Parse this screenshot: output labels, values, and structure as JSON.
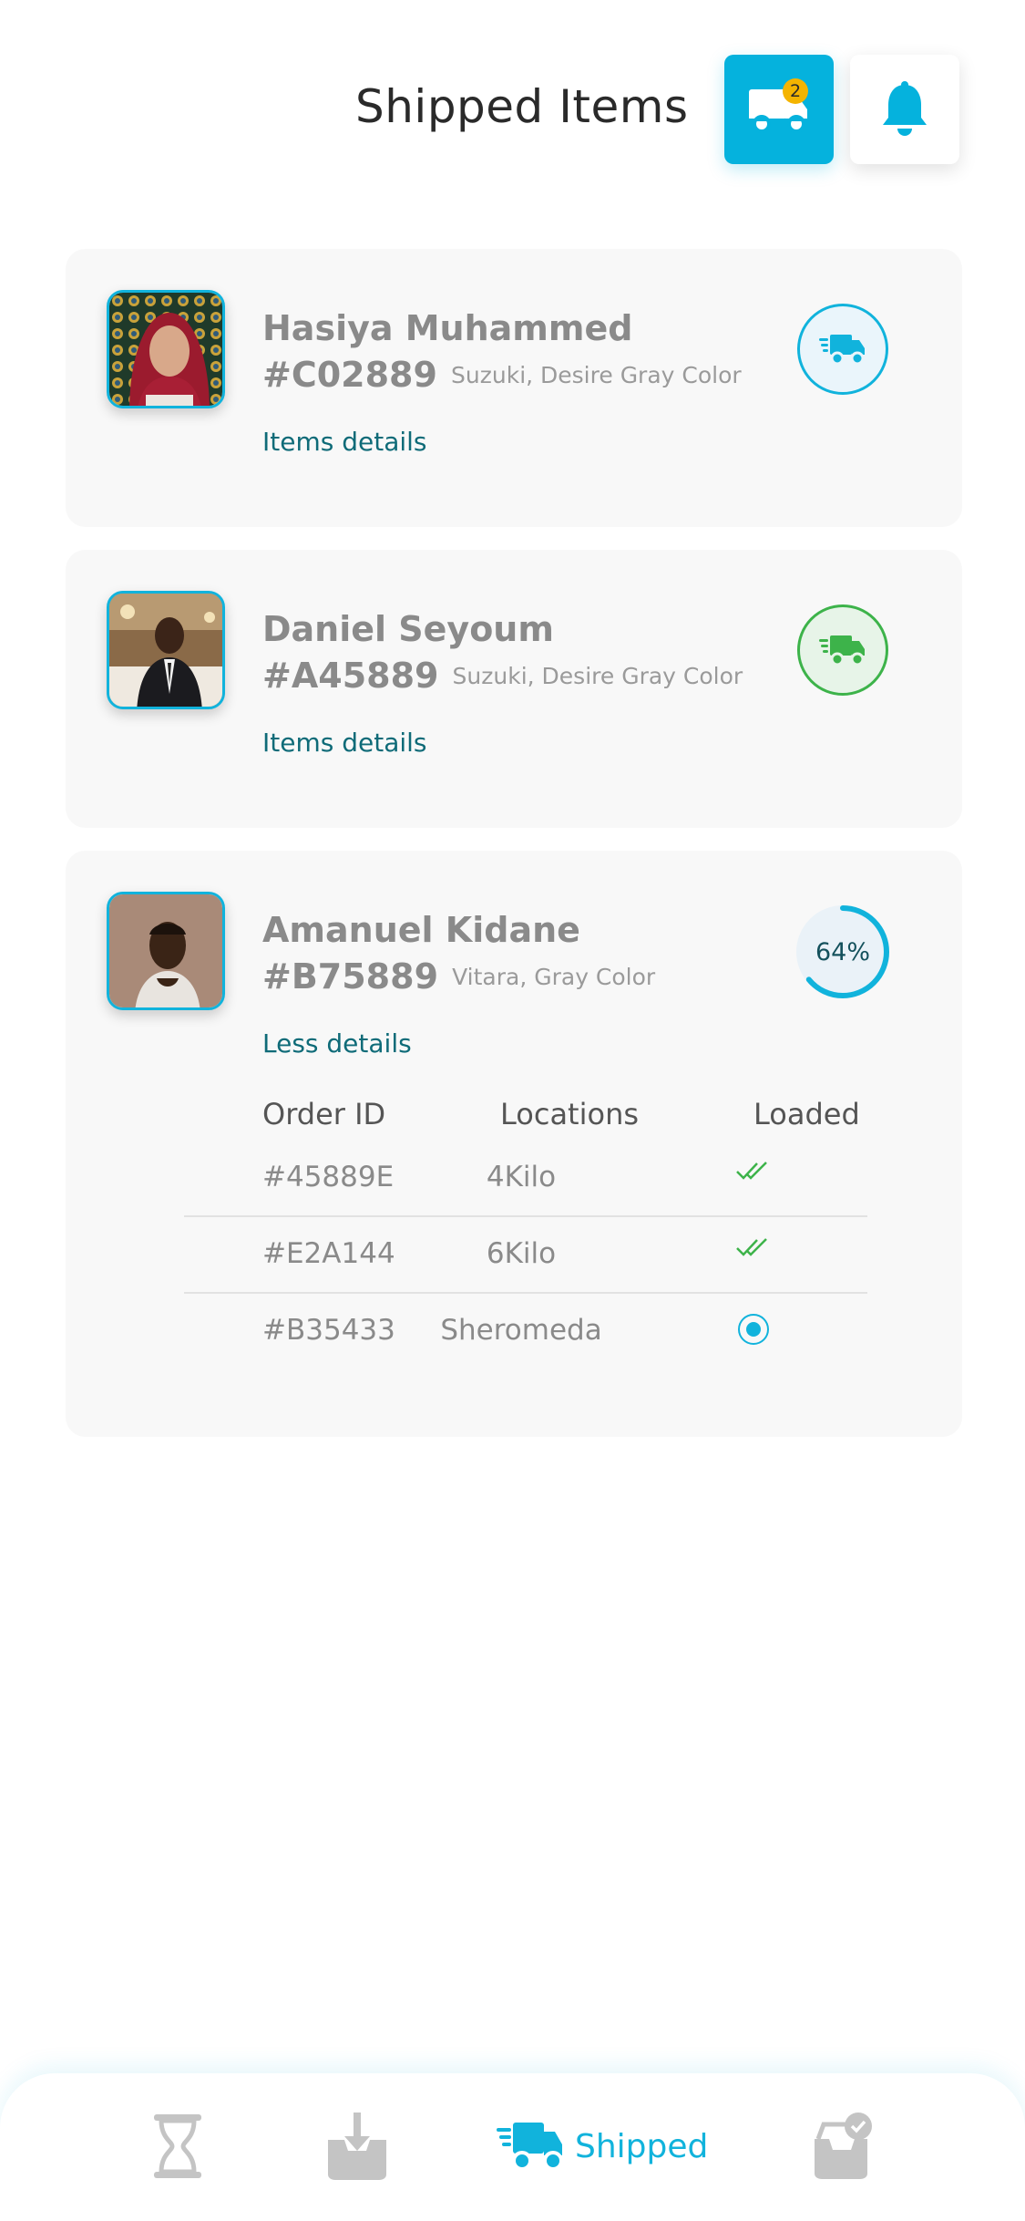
{
  "header": {
    "title": "Shipped Items",
    "truck_badge": "2",
    "truck_icon": "truck-icon",
    "bell_icon": "bell-icon"
  },
  "colors": {
    "accent": "#05b2dd",
    "green": "#3db34a",
    "link": "#0f6b78",
    "badge": "#f4b400"
  },
  "shipments": [
    {
      "name": "Hasiya Muhammed",
      "code": "#C02889",
      "vehicle": "Suzuki, Desire Gray Color",
      "details_label": "Items details",
      "status": "in-transit",
      "status_icon": "fast-truck-icon"
    },
    {
      "name": "Daniel Seyoum",
      "code": "#A45889",
      "vehicle": "Suzuki, Desire Gray Color",
      "details_label": "Items details",
      "status": "delivered",
      "status_icon": "fast-truck-icon"
    },
    {
      "name": "Amanuel Kidane",
      "code": "#B75889",
      "vehicle": "Vitara, Gray Color",
      "details_label": "Less details",
      "progress_label": "64%",
      "progress": 0.64,
      "table": {
        "headers": [
          "Order ID",
          "Locations",
          "Loaded"
        ],
        "rows": [
          {
            "order": "#45889E",
            "location": "4Kilo",
            "loaded": "double-check-icon"
          },
          {
            "order": "#E2A144",
            "location": "6Kilo",
            "loaded": "double-check-icon"
          },
          {
            "order": "#B35433",
            "location": "Sheromeda",
            "loaded": "radio-selected-icon"
          }
        ]
      }
    }
  ],
  "bottom_nav": {
    "items": [
      {
        "icon": "hourglass-icon",
        "label": ""
      },
      {
        "icon": "download-tray-icon",
        "label": ""
      },
      {
        "icon": "fast-truck-icon",
        "label": "Shipped"
      },
      {
        "icon": "tray-check-icon",
        "label": ""
      }
    ],
    "active_index": 2
  }
}
